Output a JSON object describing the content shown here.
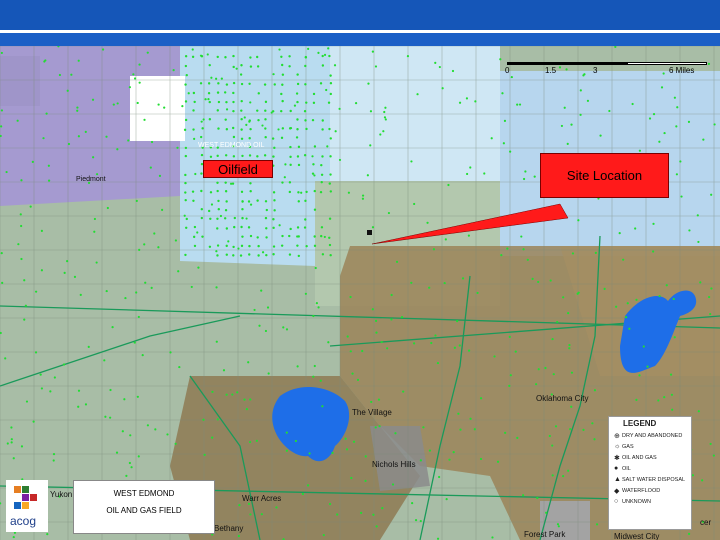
{
  "map": {
    "callouts": {
      "oilfield": "Oilfield",
      "site": "Site Location"
    },
    "field_label": "WEST EDMOND OIL",
    "scale_labels": [
      "0",
      "1.5",
      "3",
      "6 Miles"
    ],
    "place_labels": {
      "piedmont": "Piedmont",
      "oklahoma_city_north": "Oklahoma",
      "the_village": "The Village",
      "oklahoma_city": "Oklahoma City",
      "nichols_hills": "Nichols Hills",
      "yukon": "Yukon",
      "warr_acres": "Warr Acres",
      "bethany": "Bethany",
      "forest_park": "Forest Park",
      "midwest_city": "Midwest City",
      "spencer": "cer"
    },
    "legend": {
      "title": "LEGEND",
      "items": [
        "DRY AND ABANDONED",
        "GAS",
        "OIL AND GAS",
        "OIL",
        "SALT WATER DISPOSAL",
        "WATERFLOOD",
        "UNKNOWN"
      ]
    },
    "title_box": {
      "line1": "WEST EDMOND",
      "line2": "OIL AND GAS FIELD"
    },
    "logo_text": "acog",
    "colors": {
      "header_blue": "#1556b8",
      "callout_red": "#ff1a1a",
      "well_green": "#22dd33",
      "lake_blue": "#1e6ee8",
      "county_purple": "#a59ad0",
      "field_blue": "#b9dcf0",
      "urban_tan": "#9b8458",
      "ground_green": "#9ab39a"
    }
  }
}
